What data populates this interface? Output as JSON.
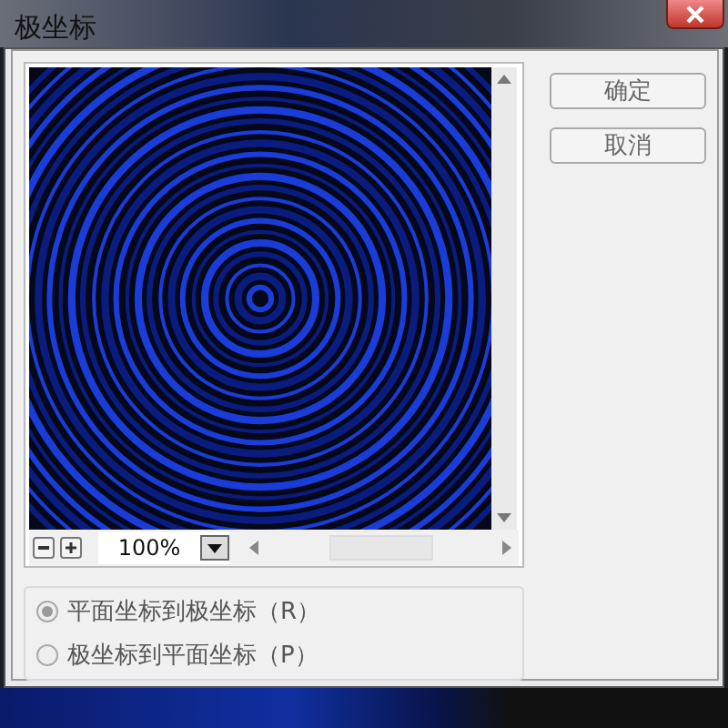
{
  "window": {
    "title": "极坐标"
  },
  "buttons": [
    "确定",
    "取消"
  ],
  "zoom": {
    "value": "100%"
  },
  "options": [
    {
      "label": "平面坐标到极坐标（R）",
      "selected": true
    },
    {
      "label": "极坐标到平面坐标（P）",
      "selected": false
    }
  ]
}
